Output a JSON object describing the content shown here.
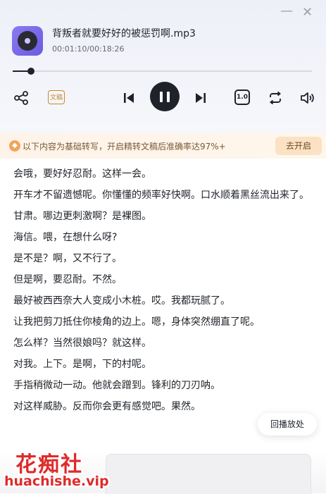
{
  "window": {
    "minimize_glyph": "—",
    "close_glyph": "✕"
  },
  "player": {
    "title": "背叛者就要好好的被惩罚啊.mp3",
    "time": "00:01:10/00:18:26",
    "progress_fraction": 0.06,
    "text_badge": "文稿",
    "speed": "1.0"
  },
  "banner": {
    "text": "以下内容为基础转写，开启精转文稿后准确率达97%+",
    "button": "去开启"
  },
  "transcript": [
    "会哦，要好好忍耐。这样一会。",
    "开车才不留遗憾呢。你懂懂的频率好快啊。口水顺着黑丝流出来了。",
    "甘肃。哪边更刺激啊？是裸图。",
    "海信。喂，在想什么呀?",
    "是不是？啊，又不行了。",
    "但是啊，要忍耐。不然。",
    "最好被西西奈大人变成小木桩。哎。我都玩腻了。",
    "让我把剪刀抵住你棱角的边上。嗯，身体突然绷直了呢。",
    "怎么样？当然很娘吗？就这样。",
    "对我。上下。是啊，下的村呢。",
    "手指稍微动一动。他就会蹭到。锋利的刀刃呐。",
    "对这样威胁。反而你会更有感觉吧。果然。"
  ],
  "float_button": "回播放处",
  "watermark": {
    "line1": "花痴社",
    "line2": "huachishe.vip"
  },
  "colors": {
    "accent_orange": "#c58a2b",
    "dark": "#1f2329",
    "watermark_red": "#e02a2a"
  }
}
